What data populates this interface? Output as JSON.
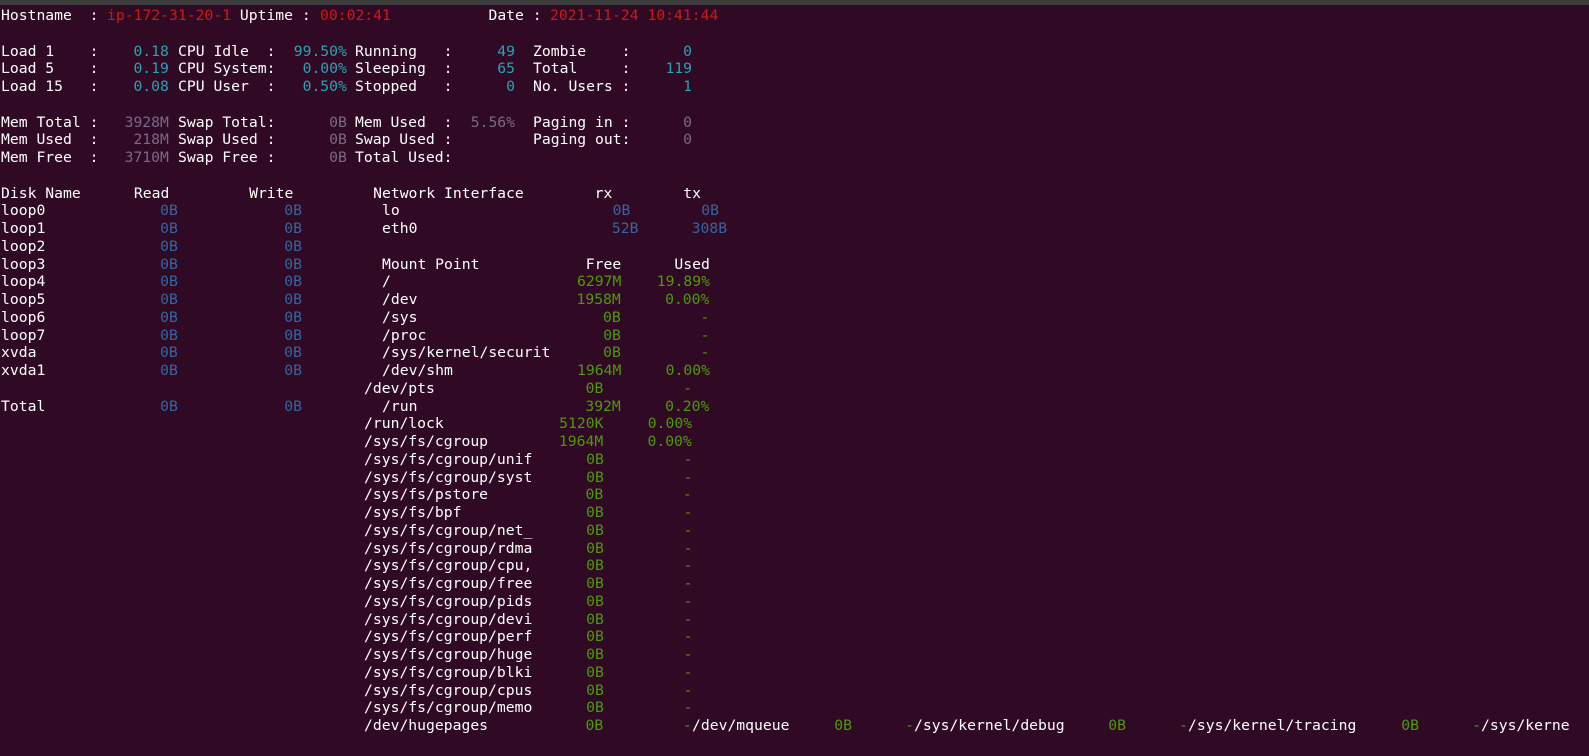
{
  "colors": {
    "background": "#300a24",
    "label": "#ffffff",
    "cyan": "#2aa3b5",
    "red": "#cc1a1a",
    "purple": "#7a6a8a",
    "blue": "#3465a4",
    "green": "#4e9a06"
  },
  "lines": [
    [
      [
        "Hostname  : ",
        "label"
      ],
      [
        "ip-172-31-20-1",
        "red"
      ],
      [
        " Uptime : ",
        "label"
      ],
      [
        "00:02:41",
        "red"
      ],
      [
        "           Date : ",
        "label"
      ],
      [
        "2021-11-24 10:41:44",
        "red"
      ]
    ],
    [],
    [
      [
        "Load 1    :",
        "label"
      ],
      [
        "    0.18 ",
        "cyan"
      ],
      [
        "CPU Idle  :",
        "label"
      ],
      [
        "  99.50% ",
        "cyan"
      ],
      [
        "Running   :",
        "label"
      ],
      [
        "     49  ",
        "cyan"
      ],
      [
        "Zombie    :",
        "label"
      ],
      [
        "      0",
        "cyan"
      ]
    ],
    [
      [
        "Load 5    :",
        "label"
      ],
      [
        "    0.19 ",
        "cyan"
      ],
      [
        "CPU System:",
        "label"
      ],
      [
        "   0.00% ",
        "cyan"
      ],
      [
        "Sleeping  :",
        "label"
      ],
      [
        "     65  ",
        "cyan"
      ],
      [
        "Total     :",
        "label"
      ],
      [
        "    119",
        "cyan"
      ]
    ],
    [
      [
        "Load 15   :",
        "label"
      ],
      [
        "    0.08 ",
        "cyan"
      ],
      [
        "CPU User  :",
        "label"
      ],
      [
        "   0.50% ",
        "cyan"
      ],
      [
        "Stopped   :",
        "label"
      ],
      [
        "      0  ",
        "cyan"
      ],
      [
        "No. Users :",
        "label"
      ],
      [
        "      1",
        "cyan"
      ]
    ],
    [],
    [
      [
        "Mem Total :",
        "label"
      ],
      [
        "   3928M ",
        "purple"
      ],
      [
        "Swap Total:",
        "label"
      ],
      [
        "      0B ",
        "purple"
      ],
      [
        "Mem Used  :",
        "label"
      ],
      [
        "  5.56%  ",
        "purple"
      ],
      [
        "Paging in :",
        "label"
      ],
      [
        "      0",
        "purple"
      ]
    ],
    [
      [
        "Mem Used  :",
        "label"
      ],
      [
        "    218M ",
        "purple"
      ],
      [
        "Swap Used :",
        "label"
      ],
      [
        "      0B ",
        "purple"
      ],
      [
        "Swap Used :",
        "label"
      ],
      [
        "         ",
        "purple"
      ],
      [
        "Paging out:",
        "label"
      ],
      [
        "      0",
        "purple"
      ]
    ],
    [
      [
        "Mem Free  :",
        "label"
      ],
      [
        "   3710M ",
        "purple"
      ],
      [
        "Swap Free :",
        "label"
      ],
      [
        "      0B ",
        "purple"
      ],
      [
        "Total Used:",
        "label"
      ]
    ],
    [],
    [
      [
        "Disk Name      Read         Write         Network Interface        rx        tx",
        "label"
      ]
    ],
    [
      [
        "loop0",
        "label"
      ],
      [
        "             0B            0B         ",
        "blue"
      ],
      [
        "lo",
        "label"
      ],
      [
        "                        0B        0B",
        "blue"
      ]
    ],
    [
      [
        "loop1",
        "label"
      ],
      [
        "             0B            0B         ",
        "blue"
      ],
      [
        "eth0",
        "label"
      ],
      [
        "                      52B      308B",
        "blue"
      ]
    ],
    [
      [
        "loop2",
        "label"
      ],
      [
        "             0B            0B",
        "blue"
      ]
    ],
    [
      [
        "loop3",
        "label"
      ],
      [
        "             0B            0B         ",
        "blue"
      ],
      [
        "Mount Point            Free      Used",
        "label"
      ]
    ],
    [
      [
        "loop4",
        "label"
      ],
      [
        "             0B            0B         ",
        "blue"
      ],
      [
        "/",
        "label"
      ],
      [
        "                     6297M    19.89%",
        "green"
      ]
    ],
    [
      [
        "loop5",
        "label"
      ],
      [
        "             0B            0B         ",
        "blue"
      ],
      [
        "/dev",
        "label"
      ],
      [
        "                  1958M     0.00%",
        "green"
      ]
    ],
    [
      [
        "loop6",
        "label"
      ],
      [
        "             0B            0B         ",
        "blue"
      ],
      [
        "/sys",
        "label"
      ],
      [
        "                     0B         -",
        "green"
      ]
    ],
    [
      [
        "loop7",
        "label"
      ],
      [
        "             0B            0B         ",
        "blue"
      ],
      [
        "/proc",
        "label"
      ],
      [
        "                    0B         -",
        "green"
      ]
    ],
    [
      [
        "xvda",
        "label"
      ],
      [
        "              0B            0B         ",
        "blue"
      ],
      [
        "/sys/kernel/securit",
        "label"
      ],
      [
        "      0B         -",
        "green"
      ]
    ],
    [
      [
        "xvda1",
        "label"
      ],
      [
        "             0B            0B         ",
        "blue"
      ],
      [
        "/dev/shm",
        "label"
      ],
      [
        "              1964M     0.00%",
        "green"
      ]
    ],
    [
      [
        "                                         ",
        "label"
      ],
      [
        "/dev/pts",
        "label"
      ],
      [
        "                 0B         -",
        "green"
      ]
    ],
    [
      [
        "Total",
        "label"
      ],
      [
        "             0B            0B         ",
        "blue"
      ],
      [
        "/run",
        "label"
      ],
      [
        "                   392M     0.20%",
        "green"
      ]
    ],
    [
      [
        "                                         ",
        "label"
      ],
      [
        "/run/lock",
        "label"
      ],
      [
        "             5120K     0.00%",
        "green"
      ]
    ],
    [
      [
        "                                         ",
        "label"
      ],
      [
        "/sys/fs/cgroup",
        "label"
      ],
      [
        "        1964M     0.00%",
        "green"
      ]
    ],
    [
      [
        "                                         ",
        "label"
      ],
      [
        "/sys/fs/cgroup/unif",
        "label"
      ],
      [
        "      0B         -",
        "green"
      ]
    ],
    [
      [
        "                                         ",
        "label"
      ],
      [
        "/sys/fs/cgroup/syst",
        "label"
      ],
      [
        "      0B         -",
        "green"
      ]
    ],
    [
      [
        "                                         ",
        "label"
      ],
      [
        "/sys/fs/pstore",
        "label"
      ],
      [
        "           0B         -",
        "green"
      ]
    ],
    [
      [
        "                                         ",
        "label"
      ],
      [
        "/sys/fs/bpf",
        "label"
      ],
      [
        "              0B         -",
        "green"
      ]
    ],
    [
      [
        "                                         ",
        "label"
      ],
      [
        "/sys/fs/cgroup/net_",
        "label"
      ],
      [
        "      0B         -",
        "green"
      ]
    ],
    [
      [
        "                                         ",
        "label"
      ],
      [
        "/sys/fs/cgroup/rdma",
        "label"
      ],
      [
        "      0B         -",
        "green"
      ]
    ],
    [
      [
        "                                         ",
        "label"
      ],
      [
        "/sys/fs/cgroup/cpu,",
        "label"
      ],
      [
        "      0B         -",
        "green"
      ]
    ],
    [
      [
        "                                         ",
        "label"
      ],
      [
        "/sys/fs/cgroup/free",
        "label"
      ],
      [
        "      0B         -",
        "green"
      ]
    ],
    [
      [
        "                                         ",
        "label"
      ],
      [
        "/sys/fs/cgroup/pids",
        "label"
      ],
      [
        "      0B         -",
        "green"
      ]
    ],
    [
      [
        "                                         ",
        "label"
      ],
      [
        "/sys/fs/cgroup/devi",
        "label"
      ],
      [
        "      0B         -",
        "green"
      ]
    ],
    [
      [
        "                                         ",
        "label"
      ],
      [
        "/sys/fs/cgroup/perf",
        "label"
      ],
      [
        "      0B         -",
        "green"
      ]
    ],
    [
      [
        "                                         ",
        "label"
      ],
      [
        "/sys/fs/cgroup/huge",
        "label"
      ],
      [
        "      0B         -",
        "green"
      ]
    ],
    [
      [
        "                                         ",
        "label"
      ],
      [
        "/sys/fs/cgroup/blki",
        "label"
      ],
      [
        "      0B         -",
        "green"
      ]
    ],
    [
      [
        "                                         ",
        "label"
      ],
      [
        "/sys/fs/cgroup/cpus",
        "label"
      ],
      [
        "      0B         -",
        "green"
      ]
    ],
    [
      [
        "                                         ",
        "label"
      ],
      [
        "/sys/fs/cgroup/memo",
        "label"
      ],
      [
        "      0B         -",
        "green"
      ]
    ],
    [
      [
        "                                         ",
        "label"
      ],
      [
        "/dev/hugepages",
        "label"
      ],
      [
        "           0B         -",
        "green"
      ],
      [
        "/dev/mqueue",
        "label"
      ],
      [
        "     0B      -",
        "green"
      ],
      [
        "/sys/kernel/debug",
        "label"
      ],
      [
        "     0B      -",
        "green"
      ],
      [
        "/sys/kernel/tracing",
        "label"
      ],
      [
        "     0B      -",
        "green"
      ],
      [
        "/sys/kerne",
        "label"
      ]
    ]
  ]
}
